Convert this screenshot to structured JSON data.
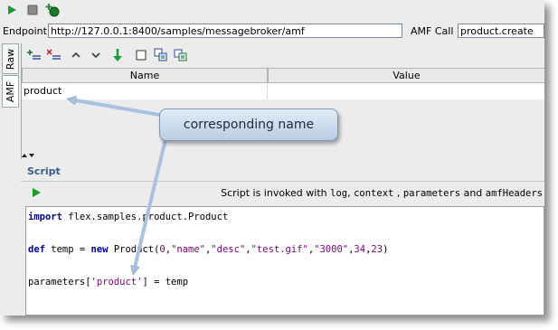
{
  "toolbar": {
    "buttons": [
      {
        "name": "run-button",
        "icon": "play-icon",
        "color": "#1a9a2a"
      },
      {
        "name": "stop-button",
        "icon": "stop-icon",
        "color": "#7a7a7a"
      },
      {
        "name": "add-breakpoint-button",
        "icon": "plus-dot-icon",
        "color": "#1a7a2a"
      }
    ]
  },
  "endpoint": {
    "label": "Endpoint",
    "value": "http://127.0.0.1:8400/samples/messagebroker/amf",
    "amf_call_label": "AMF Call",
    "amf_call_value": "product.create"
  },
  "side_tabs": [
    "Raw",
    "AMF"
  ],
  "params_toolbar": {
    "buttons": [
      {
        "name": "add-param-button",
        "icon": "add-list-icon"
      },
      {
        "name": "remove-param-button",
        "icon": "remove-list-icon"
      },
      {
        "name": "move-up-button",
        "icon": "chevron-up-icon"
      },
      {
        "name": "move-down-button",
        "icon": "chevron-down-icon"
      },
      {
        "name": "move-bottom-button",
        "icon": "arrow-down-icon"
      },
      {
        "name": "checkbox-button",
        "icon": "checkbox-icon"
      },
      {
        "name": "copy-button",
        "icon": "copy-icon"
      },
      {
        "name": "paste-button",
        "icon": "paste-icon"
      }
    ]
  },
  "table": {
    "columns": [
      "Name",
      "Value"
    ],
    "rows": [
      {
        "name": "product",
        "value": ""
      }
    ]
  },
  "script": {
    "title": "Script",
    "run_hint_prefix": "Script is invoked with ",
    "run_hint_vars": [
      "log",
      "context",
      "parameters",
      "amfHeaders"
    ],
    "run_hint_sep1": ", ",
    "run_hint_sep2": " , ",
    "run_hint_and": " and ",
    "code": {
      "line1": {
        "kw": "import",
        "rest": " flex.samples.product.Product"
      },
      "line2": {
        "kw1": "def",
        "mid1": " temp = ",
        "kw2": "new",
        "mid2": " Product(",
        "args": [
          {
            "t": "num",
            "v": "0"
          },
          {
            "t": "str",
            "v": "\"name\""
          },
          {
            "t": "str",
            "v": "\"desc\""
          },
          {
            "t": "str",
            "v": "\"test.gif\""
          },
          {
            "t": "str",
            "v": "\"3000\""
          },
          {
            "t": "num",
            "v": "34"
          },
          {
            "t": "num",
            "v": "23"
          }
        ],
        "end": ")"
      },
      "line3": {
        "pre": "parameters[",
        "str": "'product'",
        "post": "] = temp"
      }
    }
  },
  "callout": {
    "text": "corresponding name"
  },
  "colors": {
    "accent": "#3a5a8c",
    "keyword": "#00008b",
    "string": "#7a007a",
    "callout_border": "#7f95b3"
  }
}
